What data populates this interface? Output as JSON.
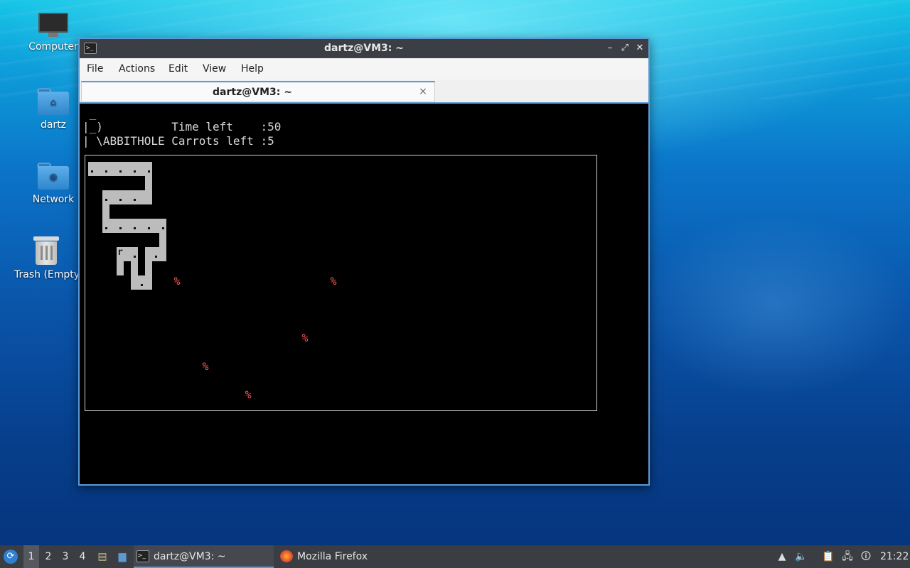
{
  "desktop": {
    "icons": [
      {
        "label": "Computer"
      },
      {
        "label": "dartz"
      },
      {
        "label": "Network"
      },
      {
        "label": "Trash (Empty)"
      }
    ]
  },
  "window": {
    "title": "dartz@VM3: ~",
    "menu": [
      "File",
      "Actions",
      "Edit",
      "View",
      "Help"
    ],
    "tab_label": "dartz@VM3: ~",
    "tab_close": "×",
    "controls": {
      "minimize": "–",
      "maximize": "⤢",
      "close": "✕"
    }
  },
  "terminal": {
    "lines": [
      " _",
      "|_)          Time left    :50",
      "| \\ABBITHOLE Carrots left :5"
    ],
    "rabbit_char": "r",
    "carrot_char": "%"
  },
  "taskbar": {
    "workspaces": [
      "1",
      "2",
      "3",
      "4"
    ],
    "active_workspace": "1",
    "tasks": [
      {
        "label": "dartz@VM3: ~",
        "active": true
      },
      {
        "label": "Mozilla Firefox",
        "active": false
      }
    ],
    "clock": "21:22"
  },
  "colors": {
    "accent": "#5b9bd5",
    "carrot": "#ff5555",
    "tunnel": "#bcbcbc"
  }
}
